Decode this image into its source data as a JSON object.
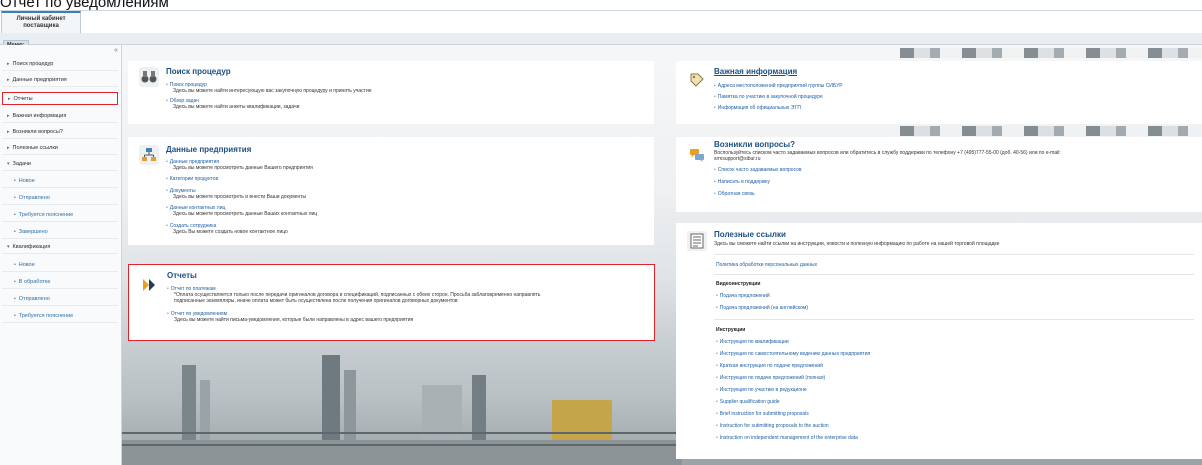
{
  "caption": "Отчет по уведомлениям",
  "header": {
    "tab_line1": "Личный кабинет",
    "tab_line2": "поставщика"
  },
  "menubar": {
    "label": "Меню:"
  },
  "sidebar": {
    "collapse": "«",
    "items": [
      {
        "label": "Поиск процедур"
      },
      {
        "label": "Данные предприятия"
      },
      {
        "label": "Отчеты"
      },
      {
        "label": "Важная информация"
      },
      {
        "label": "Возникли вопросы?"
      },
      {
        "label": "Полезные ссылки"
      },
      {
        "label": "Задачи"
      },
      {
        "label": "Новое"
      },
      {
        "label": "Отправлено"
      },
      {
        "label": "Требуется пояснение"
      },
      {
        "label": "Завершено"
      },
      {
        "label": "Квалификация"
      },
      {
        "label": "Новое"
      },
      {
        "label": "В обработке"
      },
      {
        "label": "Отправлено"
      },
      {
        "label": "Требуется пояснение"
      }
    ]
  },
  "search": {
    "title": "Поиск процедур",
    "link1": "Поиск процедур",
    "desc1": "Здесь вы можете найти интересующую вас закупочную процедуру и принять участие",
    "link2": "Обзор задач",
    "desc2": "Здесь вы можете найти анкеты квалификации, задачи"
  },
  "company": {
    "title": "Данные предприятия",
    "link1": "Данные предприятия",
    "desc1": "Здесь вы можете просмотреть данные Вашего предприятия",
    "link2": "Категории продуктов",
    "link3": "Документы",
    "desc3": "Здесь вы можете просмотреть и внести Ваши документы",
    "link4": "Данные контактных лиц",
    "desc4": "Здесь вы можете просмотреть данные Ваших контактных лиц",
    "link5": "Создать сотрудника",
    "desc5": "Здесь Вы можете создать новое контактное лицо"
  },
  "reports": {
    "title": "Отчеты",
    "link1": "Отчет по платежам",
    "desc1a": "*Оплата осуществляется только после передачи оригиналов договора и спецификаций, подписанных с обеих сторон. Просьба заблаговременно направлять",
    "desc1b": "подписанные экземпляры, иначе оплата может быть осуществлена после получения оригиналов договорных документов",
    "link2": "Отчет по уведомлениям",
    "desc2": "Здесь вы можете найти письма-уведомления, которые были направлены в адрес вашего предприятия"
  },
  "important": {
    "title": "Важная информация",
    "link1": "Адреса местоположений предприятий группы СИБУР",
    "link2": "Памятка по участию в закупочной процедуре",
    "link3": "Информация об официальных ЭТП"
  },
  "questions": {
    "title": "Возникли вопросы?",
    "desc_a": "Воспользуйтесь списком часто задаваемых вопросов или обратитесь в службу поддержки по телефону +7 (495)777-55-00 (доб. 40-56) или по e-mail:",
    "desc_b": "srmsupport@sibur.ru",
    "link1": "Список часто задаваемых вопросов",
    "link2": "Написать в поддержку",
    "link3": "Обратная связь"
  },
  "links": {
    "title": "Полезные ссылки",
    "desc": "Здесь вы сможете найти ссылки на инструкции, новости и полезную информацию по работе на нашей торговой площадке",
    "policy": "Политика обработки персональных данных",
    "video_header": "Видеоинструкции",
    "video1": "Подача предложений",
    "video2": "Подача предложений (на английском)",
    "instr_header": "Инструкции",
    "instr": [
      "Инструкция по квалификации",
      "Инструкция по самостоятельному ведению данных предприятия",
      "Краткая инструкция по подаче предложений",
      "Инструкция по подаче предложений (полная)",
      "Инструкция по участию в редукционе",
      "Supplier qualification guide",
      "Brief instruction for submitting proposals",
      "Instruction for submitting proposals to the auction",
      "Instruction on independent management of the enterprise data"
    ]
  }
}
